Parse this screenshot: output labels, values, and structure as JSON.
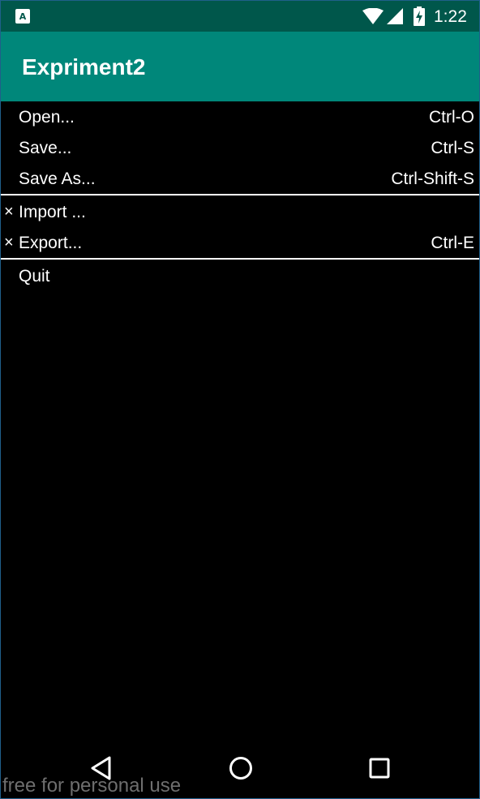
{
  "status_bar": {
    "time": "1:22",
    "notification_icon": "A",
    "icons": [
      "app-notification-icon",
      "wifi-icon",
      "cell-signal-icon",
      "battery-charging-icon"
    ]
  },
  "app_bar": {
    "title": "Expriment2"
  },
  "menu": {
    "items": [
      {
        "mark": "",
        "label": "Open...",
        "shortcut": "Ctrl-O"
      },
      {
        "mark": "",
        "label": "Save...",
        "shortcut": "Ctrl-S"
      },
      {
        "mark": "",
        "label": "Save As...",
        "shortcut": "Ctrl-Shift-S"
      },
      {
        "mark": "×",
        "label": "Import ...",
        "shortcut": ""
      },
      {
        "mark": "×",
        "label": "Export...",
        "shortcut": "Ctrl-E"
      },
      {
        "mark": "",
        "label": "Quit",
        "shortcut": ""
      }
    ]
  },
  "nav_bar": {
    "icons": [
      "back-icon",
      "home-icon",
      "recents-icon"
    ]
  },
  "watermark": "free for personal use",
  "colors": {
    "status_bar": "#00574b",
    "app_bar": "#00877a",
    "background": "#000000",
    "text": "#ffffff",
    "watermark": "#6e6e6e"
  }
}
